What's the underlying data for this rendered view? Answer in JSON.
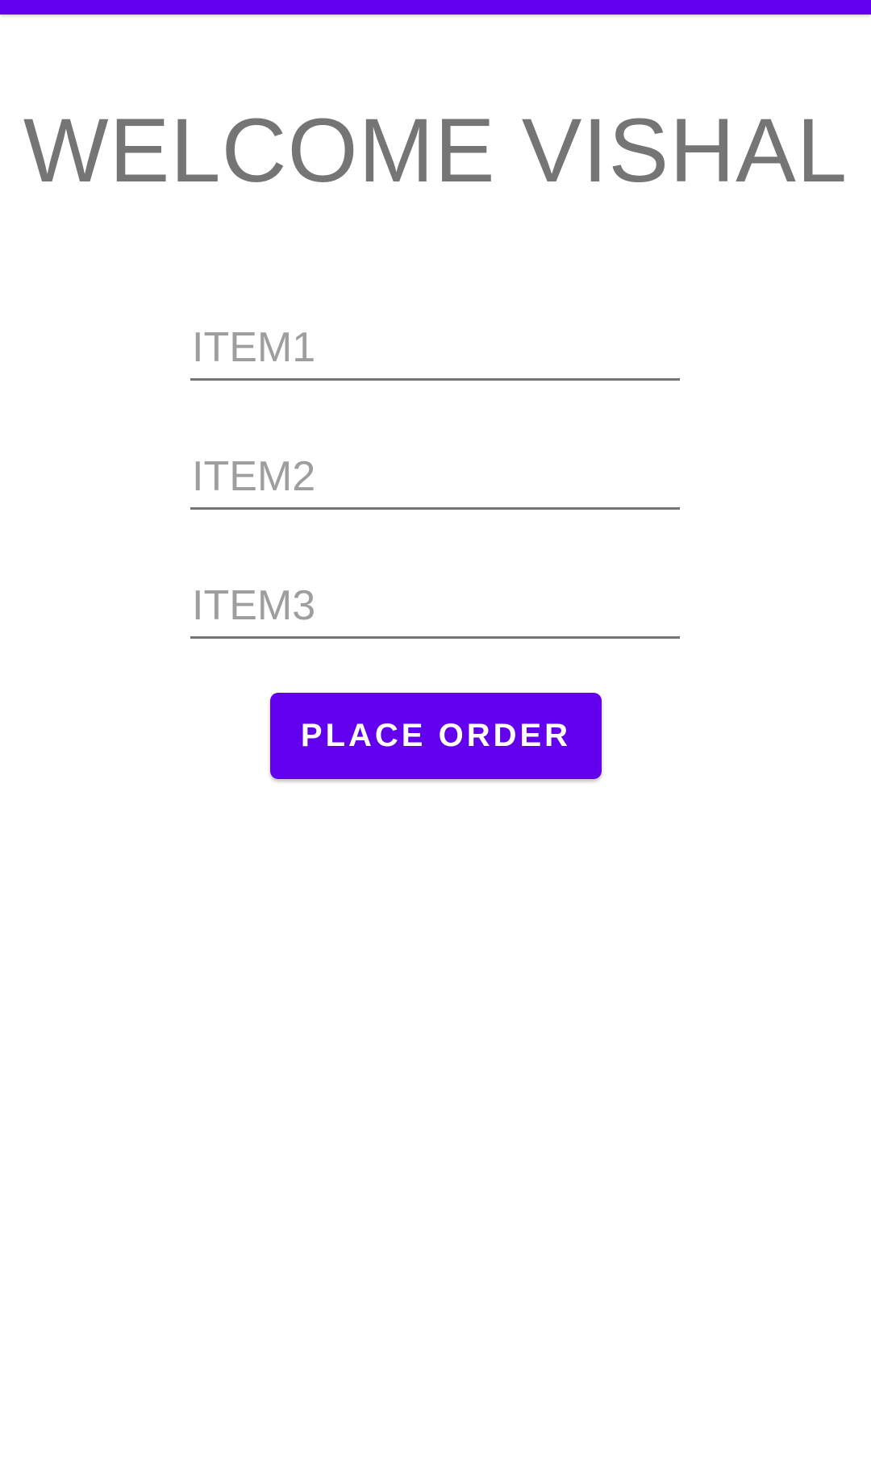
{
  "colors": {
    "accent": "#6200ee",
    "title_text": "#757575",
    "hint_text": "#9e9e9e",
    "underline": "#757575",
    "button_text": "#ffffff",
    "background": "#ffffff"
  },
  "header": {
    "title": "WELCOME VISHAL"
  },
  "form": {
    "fields": [
      {
        "placeholder": "ITEM1",
        "value": ""
      },
      {
        "placeholder": "ITEM2",
        "value": ""
      },
      {
        "placeholder": "ITEM3",
        "value": ""
      }
    ],
    "submit_label": "PLACE ORDER"
  }
}
